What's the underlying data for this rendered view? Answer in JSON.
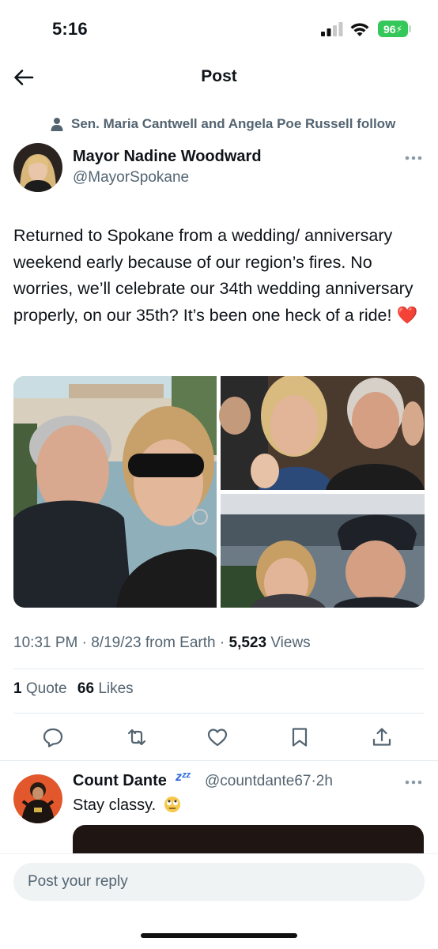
{
  "status_bar": {
    "time": "5:16",
    "battery": "96"
  },
  "header": {
    "title": "Post"
  },
  "social_context": "Sen. Maria Cantwell and Angela Poe Russell follow",
  "author": {
    "name": "Mayor Nadine Woodward",
    "handle": "@MayorSpokane"
  },
  "tweet": {
    "text": "Returned to Spokane from a wedding/ anniversary weekend early because of our region’s fires. No worries, we’ll celebrate our 34th wedding anniversary properly, on our 35th? It’s been one heck of a ride! ❤️",
    "time": "10:31 PM",
    "sep1": " · ",
    "date": "8/19/23",
    "source": " from Earth",
    "sep2": " · ",
    "views_count": "5,523",
    "views_label": " Views",
    "quotes_count": "1",
    "quotes_label": " Quote",
    "likes_count": "66",
    "likes_label": " Likes"
  },
  "icons": {
    "back": "back-arrow-icon",
    "person": "person-icon",
    "more": "more-icon",
    "reply": "reply-icon",
    "retweet": "retweet-icon",
    "like": "heart-icon",
    "bookmark": "bookmark-icon",
    "share": "share-icon"
  },
  "reply": {
    "name": "Count Dante",
    "zzz": "zᶻᶻ",
    "handle": "@countdante67",
    "sep": "·",
    "time": "2h",
    "text": "Stay classy."
  },
  "composer": {
    "placeholder": "Post your reply"
  },
  "colors": {
    "text": "#0f1419",
    "secondary": "#536471",
    "battery": "#34c759",
    "divider": "#e6ecf0",
    "input_bg": "#eff3f4"
  }
}
